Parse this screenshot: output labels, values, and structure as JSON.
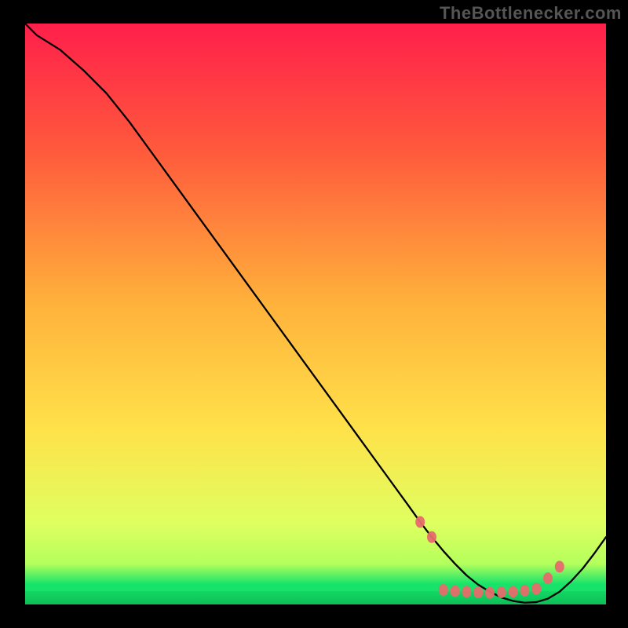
{
  "attribution": "TheBottlenecker.com",
  "chart_data": {
    "type": "line",
    "title": "",
    "xlabel": "",
    "ylabel": "",
    "xlim": [
      0,
      100
    ],
    "ylim": [
      0,
      100
    ],
    "x": [
      0,
      2,
      6,
      10,
      14,
      18,
      22,
      26,
      30,
      34,
      38,
      42,
      46,
      50,
      54,
      58,
      62,
      66,
      68,
      70,
      72,
      74,
      76,
      78,
      80,
      82,
      84,
      86,
      88,
      90,
      92,
      94,
      96,
      98,
      100
    ],
    "y": [
      100,
      98,
      95.5,
      92,
      88,
      83,
      77.5,
      72,
      66.5,
      61,
      55.5,
      50,
      44.5,
      39,
      33.5,
      28,
      22.5,
      17,
      14.2,
      11.6,
      9.2,
      7,
      5,
      3.4,
      2.2,
      1.2,
      0.6,
      0.3,
      0.4,
      1,
      2.2,
      4,
      6.2,
      8.8,
      11.6
    ],
    "markers_x": [
      68,
      70,
      72,
      74,
      76,
      78,
      80,
      82,
      84,
      86,
      88,
      90,
      92
    ],
    "markers_y": [
      14.2,
      11.6,
      2.5,
      2.3,
      2.2,
      2.1,
      2.0,
      2.1,
      2.2,
      2.4,
      2.7,
      4.5,
      6.5
    ],
    "colors": {
      "top": "#ff1f4b",
      "mid": "#ffe24a",
      "low": "#dfff60",
      "narrow_band": "#17e36a",
      "bottom": "#0dbf57",
      "line": "#000000",
      "marker": "#e76c6c"
    }
  }
}
